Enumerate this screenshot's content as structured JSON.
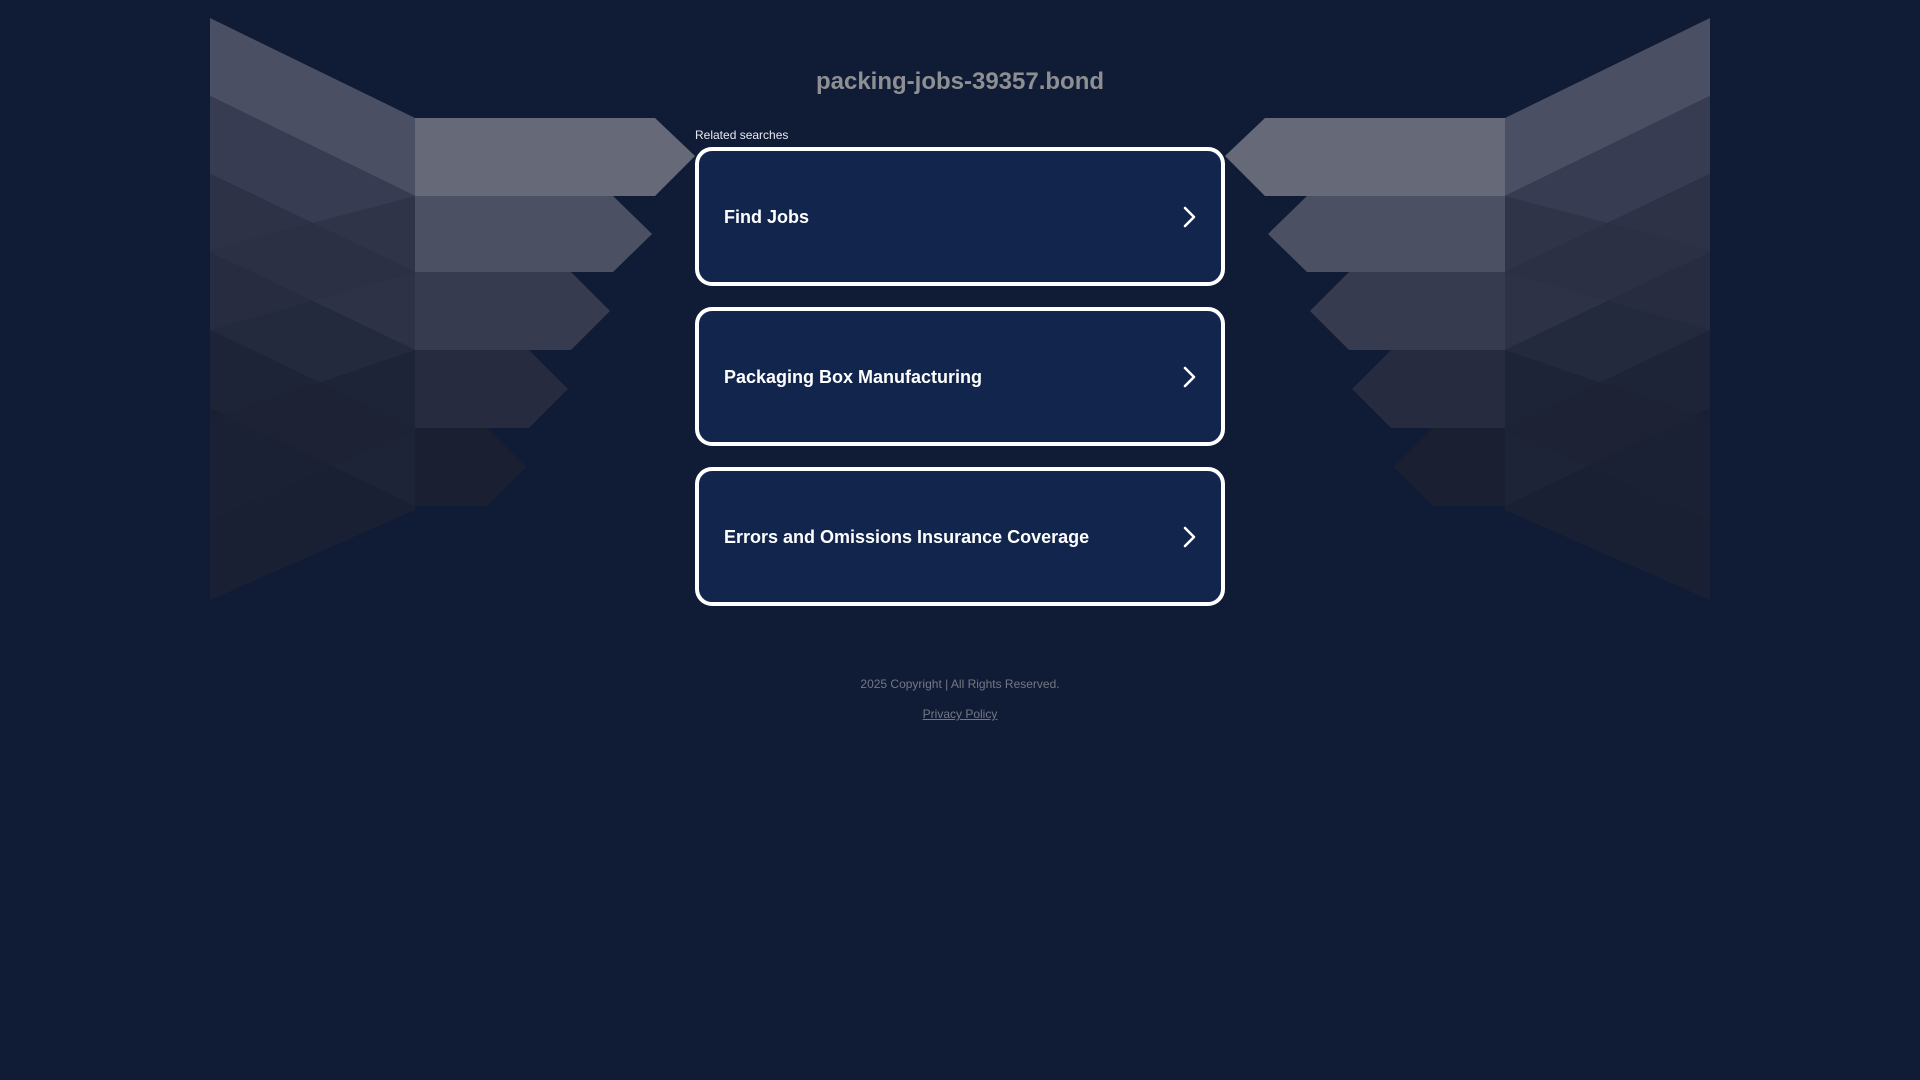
{
  "header": {
    "domain": "packing-jobs-39357.bond"
  },
  "related": {
    "label": "Related searches",
    "items": [
      {
        "label": "Find Jobs",
        "icon": "chevron-right-icon"
      },
      {
        "label": "Packaging Box Manufacturing",
        "icon": "chevron-right-icon"
      },
      {
        "label": "Errors and Omissions Insurance Coverage",
        "icon": "chevron-right-icon"
      }
    ]
  },
  "footer": {
    "copyright": "2025 Copyright | All Rights Reserved.",
    "privacy": "Privacy Policy"
  },
  "colors": {
    "background": "#101c36",
    "card": "#12254d",
    "card_border": "#ffffff",
    "title": "#8e8f92",
    "footer_text": "#737882"
  }
}
